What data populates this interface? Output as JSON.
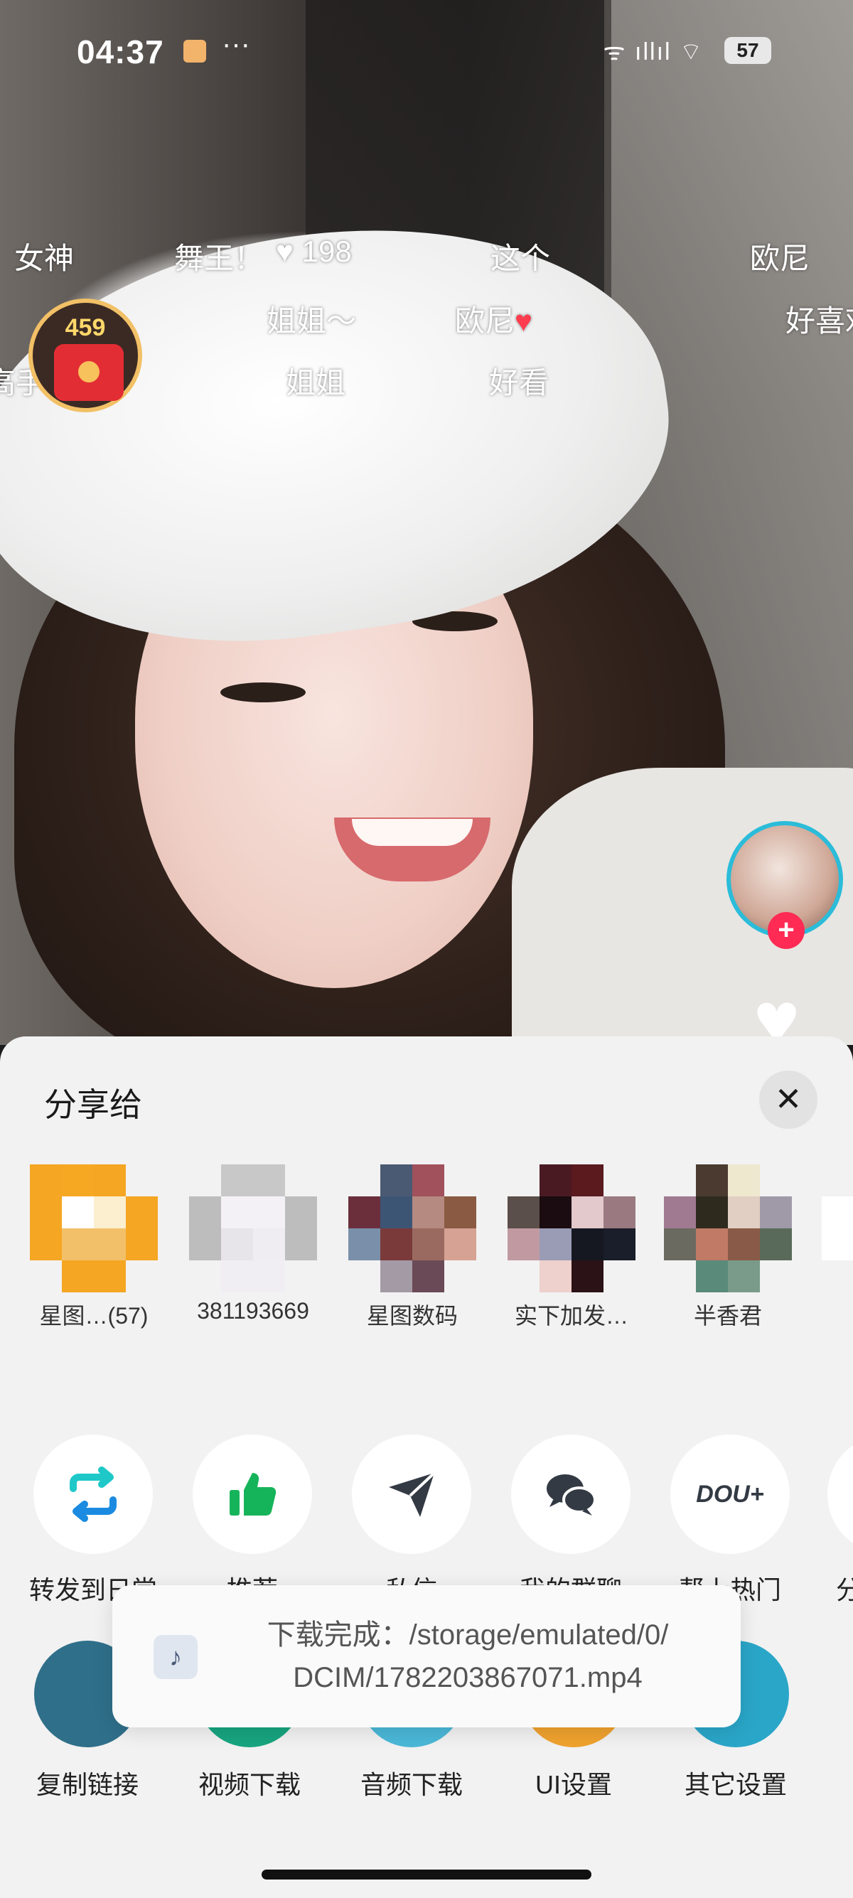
{
  "status_bar": {
    "time": "04:37",
    "dots": "···",
    "signal": "ᯤ ıllıl ⌔",
    "battery": "57"
  },
  "danmaku": [
    "女神",
    "舞王！",
    "198",
    "这个",
    "欧尼",
    "姐姐～",
    "欧尼",
    "好喜欢",
    "高手",
    "姐姐",
    "好看"
  ],
  "red_packet": {
    "count": "459"
  },
  "share_sheet": {
    "title": "分享给",
    "close": "✕",
    "friends": [
      {
        "label": "星图…(57)"
      },
      {
        "label": "381193669"
      },
      {
        "label": "星图数码"
      },
      {
        "label": "实下加发…"
      },
      {
        "label": "半香君"
      }
    ],
    "actions": [
      {
        "label": "转发到日常",
        "icon": "repost-icon"
      },
      {
        "label": "推荐",
        "icon": "thumbs-up-icon"
      },
      {
        "label": "私信",
        "icon": "send-icon"
      },
      {
        "label": "我的群聊",
        "icon": "chat-icon"
      },
      {
        "label": "帮上热门",
        "icon": "dou-plus-icon",
        "icon_text": "DOU+"
      },
      {
        "label": "分享",
        "icon": "share-icon"
      }
    ],
    "tools": [
      {
        "label": "复制链接",
        "color": "#2f6f8a"
      },
      {
        "label": "视频下载",
        "color": "#17a57f"
      },
      {
        "label": "音频下载",
        "color": "#4bb8d8"
      },
      {
        "label": "UI设置",
        "color": "#f0a22e"
      },
      {
        "label": "其它设置",
        "color": "#2aa6c8"
      }
    ]
  },
  "toast": {
    "message_line1": "下载完成：/storage/emulated/0/",
    "message_line2": "DCIM/1782203867071.mp4",
    "icon": "♪"
  }
}
